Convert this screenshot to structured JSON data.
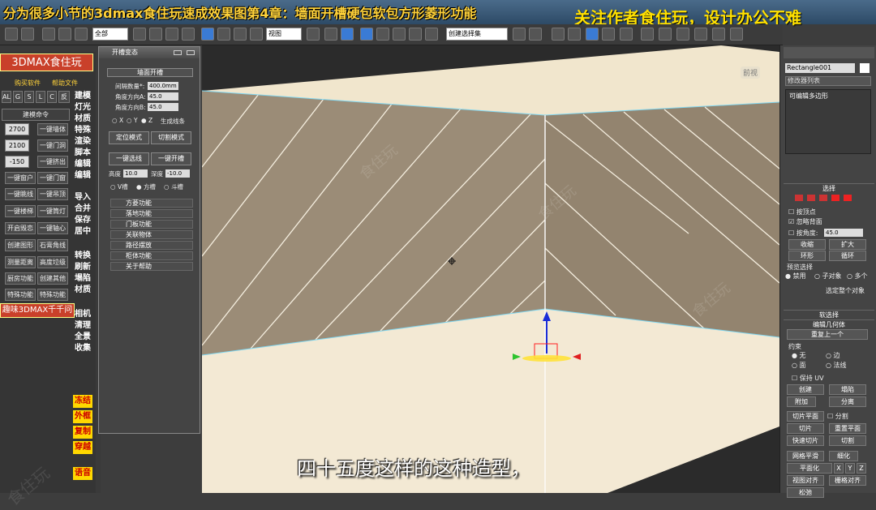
{
  "title": {
    "left": "分为很多小节的3dmax食住玩速成效果图第4章：墙面开槽硬包软包方形菱形功能",
    "right": "关注作者食住玩，设计办公不难"
  },
  "toolbar": {
    "filter_value": "全部",
    "view_value": "视图",
    "selset_value": "创建选择集"
  },
  "left_panel": {
    "header": "3DMAX食住玩",
    "links": [
      "购买软件",
      "帮助文件"
    ],
    "mode_buttons": [
      "ALL",
      "G",
      "S",
      "L",
      "C",
      "反"
    ],
    "section_title": "建模命令",
    "rows": [
      {
        "value": "2700",
        "label": "一键墙体"
      },
      {
        "value": "2100",
        "label": "一键门洞"
      },
      {
        "value": "-150",
        "label": "一键挤出"
      }
    ],
    "buttons": [
      [
        "一键窗户",
        "一键门窗"
      ],
      [
        "一键眺线",
        "一键吊顶"
      ],
      [
        "一键楼梯",
        "一键筒灯"
      ],
      [
        "开启毁恋",
        "一键轴心"
      ],
      [
        "创建图形",
        "石膏角线"
      ],
      [
        "测量距离",
        "高度垃级"
      ],
      [
        "厨房功能",
        "创建其他"
      ],
      [
        "特殊功能",
        "特殊功能"
      ]
    ],
    "footer": "趣味3DMAX千千问",
    "right_col_1": [
      "建模",
      "灯光",
      "材质",
      "特殊",
      "渲染",
      "脚本",
      "编辑",
      "编辑"
    ],
    "right_col_2": [
      "导入",
      "合并",
      "保存",
      "居中"
    ],
    "right_col_3": [
      "转换",
      "刷新",
      "塌陷",
      "材质"
    ],
    "right_col_4": [
      "相机",
      "清理",
      "全景",
      "收集"
    ],
    "yellow_buttons": [
      "冻结",
      "外框",
      "复制",
      "穿越",
      "语音"
    ]
  },
  "dialog": {
    "title": "开槽变态",
    "section": "墙面开槽",
    "fields": [
      {
        "label": "间隔数量*:",
        "value": "400.0mm"
      },
      {
        "label": "角度方向A:",
        "value": "45.0"
      },
      {
        "label": "角度方向B:",
        "value": "45.0"
      }
    ],
    "axis": [
      "X",
      "Y",
      "Z"
    ],
    "gen_line": "生成线条",
    "btn_row1": [
      "定位模式",
      "切割模式"
    ],
    "btn_row2": [
      "一键选线",
      "一键开槽"
    ],
    "height_label": "高度",
    "height_value": "10.0",
    "depth_label": "深度",
    "depth_value": "-10.0",
    "shape_opts": [
      "V槽",
      "方槽",
      "斗槽"
    ],
    "items": [
      "方菱功能",
      "落地功能",
      "门板功能",
      "关联物体",
      "路径摆放",
      "柜体功能",
      "关于帮助"
    ]
  },
  "right_panel": {
    "object_name": "Rectangle001",
    "modifier_list": "修改器列表",
    "stack_item": "可编辑多边形",
    "select_section": "选择",
    "chk_vertex": "按顶点",
    "chk_backface": "忽略背面",
    "chk_angle": "按角度:",
    "angle_value": "45.0",
    "btn_shrink": "收缩",
    "btn_grow": "扩大",
    "btn_ring": "环形",
    "btn_loop": "循环",
    "preview_title": "预览选择",
    "preview_opts": [
      "禁用",
      "子对象",
      "多个"
    ],
    "select_all": "选定整个对象",
    "soft_section": "软选择",
    "edit_geo_section": "编辑几何体",
    "repeat_last": "重复上一个",
    "constraint_title": "约束",
    "constraint_opts": [
      "无",
      "边",
      "面",
      "法线"
    ],
    "keep_uv": "保持 UV",
    "btn_create": "创建",
    "btn_collapse": "塌陷",
    "btn_attach": "附加",
    "btn_detach": "分离",
    "btn_slice_plane": "切片平面",
    "btn_split": "分割",
    "btn_slice": "切片",
    "btn_reset_plane": "重置平面",
    "btn_quickslice": "快速切片",
    "btn_cut": "切割",
    "btn_meshsmooth": "网格平滑",
    "btn_refine": "细化",
    "btn_planarize": "平面化",
    "xyz": [
      "X",
      "Y",
      "Z"
    ],
    "btn_view_align": "视图对齐",
    "btn_grid_align": "栅格对齐",
    "btn_relax": "松弛"
  },
  "viewport": {
    "label": "前视",
    "watermark": "食住玩"
  },
  "subtitle": "四十五度这样的这种造型，"
}
